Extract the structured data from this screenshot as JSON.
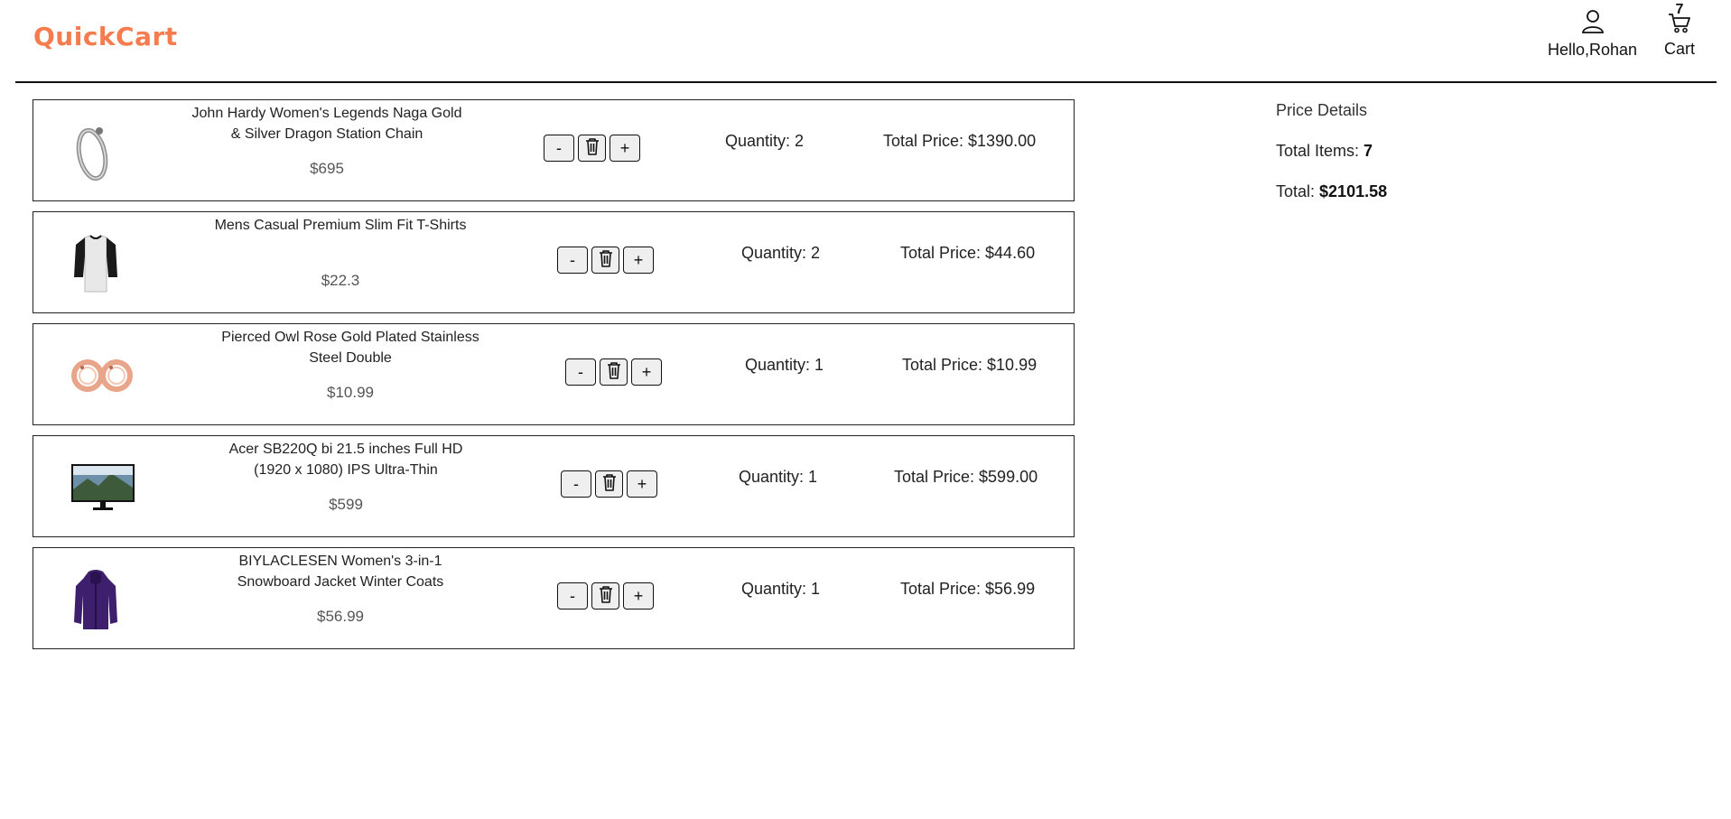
{
  "brand": {
    "name": "QuickCart",
    "color": "#f47c4f"
  },
  "header": {
    "user_label": "Hello,Rohan",
    "cart_label": "Cart",
    "cart_count": "7"
  },
  "cart": {
    "items": [
      {
        "title": "John Hardy Women's Legends Naga Gold & Silver Dragon Station Chain",
        "price": "$695",
        "quantity_label": "Quantity: 2",
        "total_label": "Total Price: $1390.00",
        "decrement": "-",
        "increment": "+",
        "image": "bracelet"
      },
      {
        "title": "Mens Casual Premium Slim Fit T-Shirts",
        "price": "$22.3",
        "quantity_label": "Quantity: 2",
        "total_label": "Total Price: $44.60",
        "decrement": "-",
        "increment": "+",
        "image": "t-shirt"
      },
      {
        "title": "Pierced Owl Rose Gold Plated Stainless Steel Double",
        "price": "$10.99",
        "quantity_label": "Quantity: 1",
        "total_label": "Total Price: $10.99",
        "decrement": "-",
        "increment": "+",
        "image": "earrings"
      },
      {
        "title": "Acer SB220Q bi 21.5 inches Full HD (1920 x 1080) IPS Ultra-Thin",
        "price": "$599",
        "quantity_label": "Quantity: 1",
        "total_label": "Total Price: $599.00",
        "decrement": "-",
        "increment": "+",
        "image": "monitor"
      },
      {
        "title": "BIYLACLESEN Women's 3-in-1 Snowboard Jacket Winter Coats",
        "price": "$56.99",
        "quantity_label": "Quantity: 1",
        "total_label": "Total Price: $56.99",
        "decrement": "-",
        "increment": "+",
        "image": "jacket"
      }
    ]
  },
  "price_details": {
    "title": "Price Details",
    "total_items_label": "Total Items: ",
    "total_items_value": "7",
    "total_label": "Total: ",
    "total_value": "$2101.58"
  }
}
